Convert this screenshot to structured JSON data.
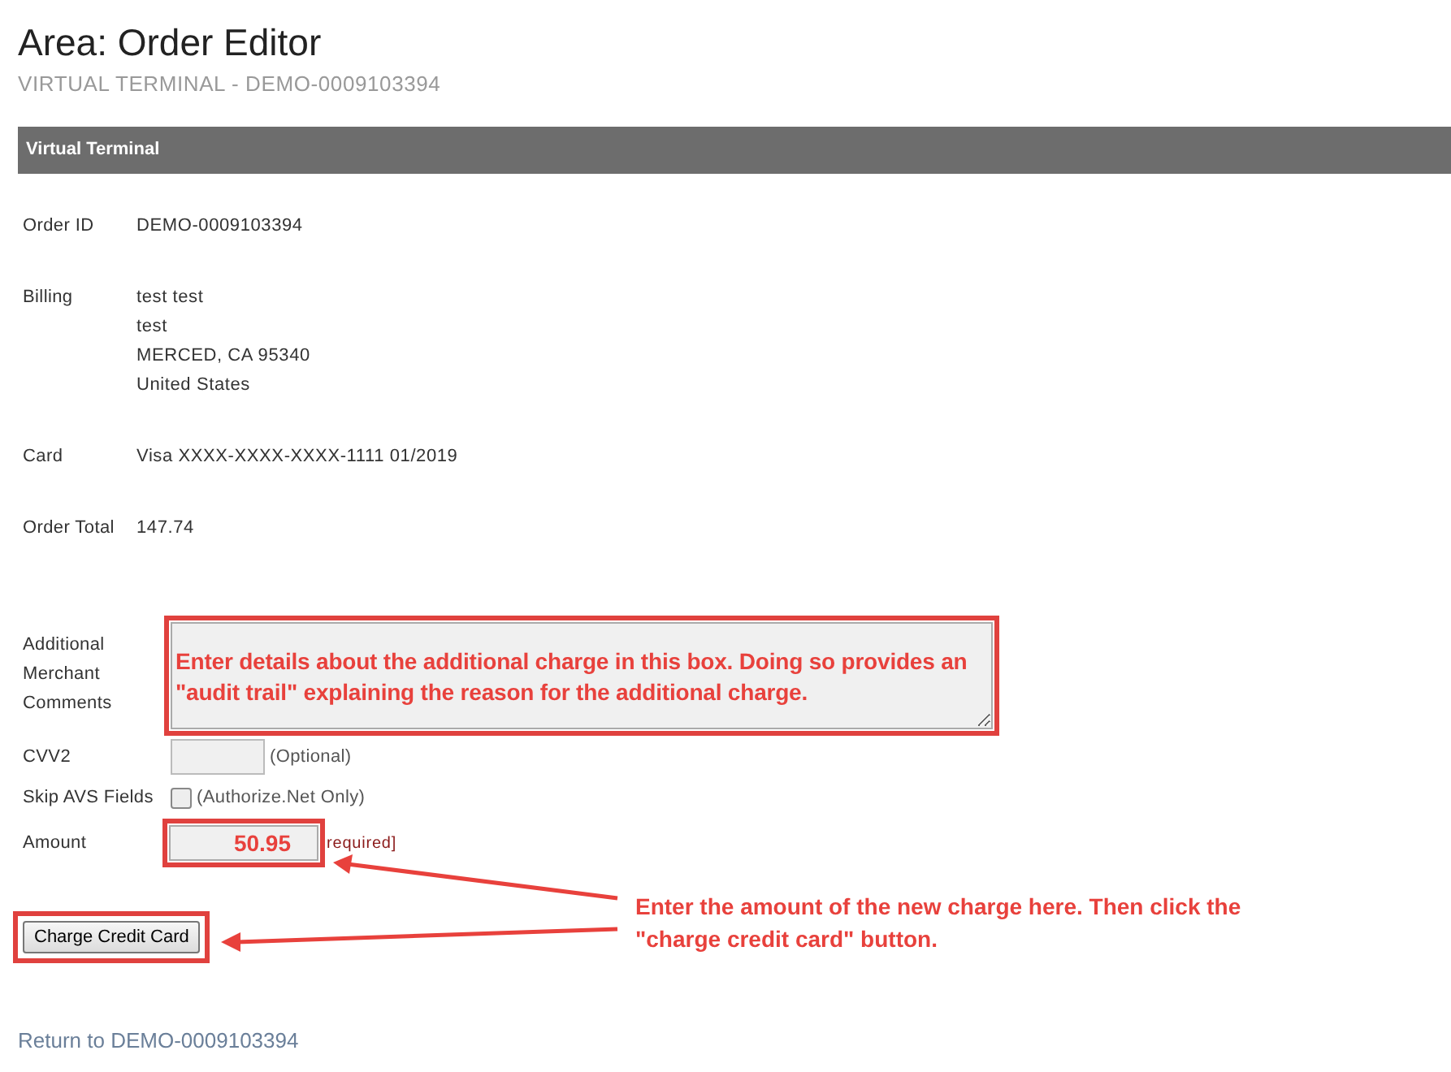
{
  "page": {
    "title": "Area: Order Editor",
    "subtitle": "VIRTUAL TERMINAL - DEMO-0009103394"
  },
  "panel": {
    "title": "Virtual Terminal"
  },
  "details": [
    {
      "label": "Order ID",
      "lines": [
        "DEMO-0009103394"
      ]
    },
    {
      "label": "Billing",
      "lines": [
        "test test",
        "test",
        "MERCED, CA 95340",
        "United States"
      ]
    },
    {
      "label": "Card",
      "lines": [
        "Visa XXXX-XXXX-XXXX-1111 01/2019"
      ]
    },
    {
      "label": "Order Total",
      "lines": [
        "147.74"
      ]
    }
  ],
  "form": {
    "comments": {
      "label": "Additional Merchant Comments",
      "value": "Enter details about the additional charge in this box. Doing so provides an \"audit trail\" explaining the reason for the additional charge."
    },
    "cvv": {
      "label": "CVV2",
      "note": "(Optional)"
    },
    "skip_avs": {
      "label": "Skip AVS Fields",
      "checked": false,
      "note": "(Authorize.Net Only)"
    },
    "amount": {
      "label": "Amount",
      "value": "50.95",
      "note": "required]"
    },
    "button": "Charge Credit Card"
  },
  "callout": "Enter the amount of the new charge here.  Then click the \"charge credit card\" button.",
  "return_link": "Return to DEMO-0009103394"
}
